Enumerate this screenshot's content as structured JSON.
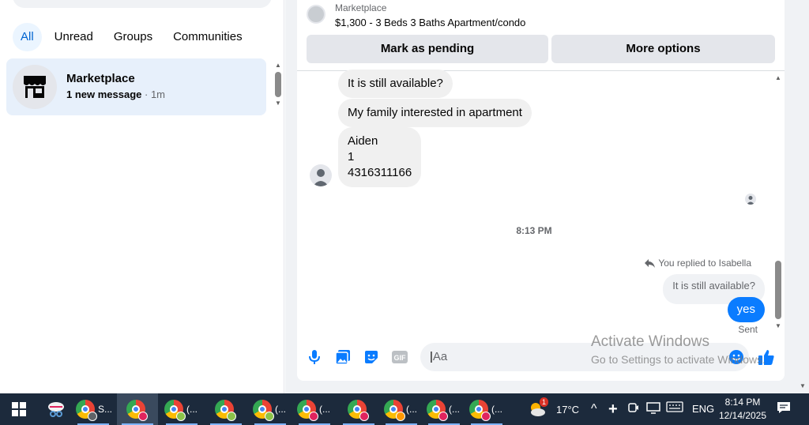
{
  "sidebar": {
    "filters": [
      "All",
      "Unread",
      "Groups",
      "Communities"
    ],
    "active_filter": "All",
    "chat": {
      "title": "Marketplace",
      "unread_text": "1 new message",
      "separator": " · ",
      "time": "1m"
    }
  },
  "conversation": {
    "header": {
      "label": "Marketplace",
      "title": "$1,300 - 3 Beds 3 Baths Apartment/condo",
      "mark_pending": "Mark as pending",
      "more_options": "More options"
    },
    "messages": {
      "m1": "It is still available?",
      "m2": "My family  interested in apartment",
      "m3": "Aiden\n1\n4316311166"
    },
    "time_divider": "8:13 PM",
    "replied_label": "You replied to Isabella",
    "quoted_text": "It is still available?",
    "my_reply": "yes",
    "status": "Sent",
    "composer_placeholder": "Aa"
  },
  "watermark": {
    "line1": "Activate Windows",
    "line2": "Go to Settings to activate Windows."
  },
  "taskbar": {
    "apps": [
      {
        "label": "S..."
      },
      {
        "label": ""
      },
      {
        "label": "(..."
      },
      {
        "label": ""
      },
      {
        "label": "(..."
      },
      {
        "label": "(..."
      },
      {
        "label": ""
      },
      {
        "label": "(..."
      },
      {
        "label": "(..."
      },
      {
        "label": "(..."
      }
    ],
    "weather_temp": "17°C",
    "weather_badge": "1",
    "language": "ENG",
    "time": "8:14 PM",
    "date": "12/14/2025"
  },
  "colors": {
    "accent": "#0a7cff",
    "filter_active_bg": "#ebf5ff",
    "filter_active_text": "#0064d1",
    "chat_selected_bg": "#e7f0fb",
    "taskbar_bg": "#1c2a3c"
  }
}
